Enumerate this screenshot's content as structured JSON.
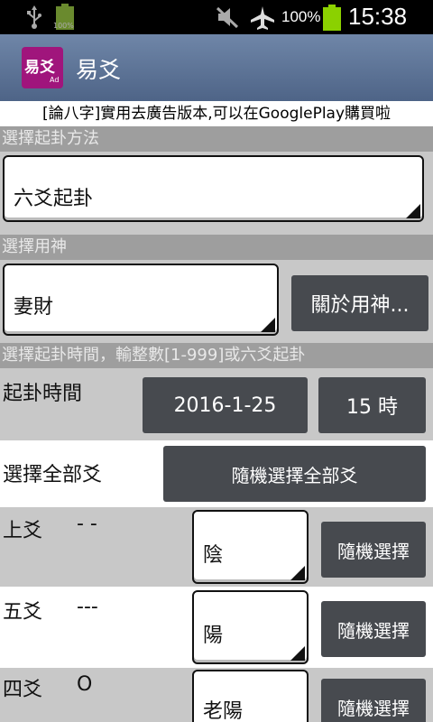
{
  "status_bar": {
    "small_battery_text": "100%",
    "battery_percent": "100%",
    "time": "15:38",
    "icons": [
      "usb-icon",
      "battery-small-icon",
      "mute-icon",
      "airplane-icon",
      "battery-icon"
    ]
  },
  "app": {
    "icon_text": "易爻",
    "icon_badge": "Ad",
    "title": "易爻"
  },
  "banner": "[論八字]實用去廣告版本,可以在GooglePlay購買啦",
  "method_section": {
    "label": "選擇起卦方法",
    "selected": "六爻起卦"
  },
  "yongshen_section": {
    "label": "選擇用神",
    "selected": "妻財",
    "about_button": "關於用神..."
  },
  "time_section": {
    "label": "選擇起卦時間，輸整數[1-999]或六爻起卦",
    "row_label": "起卦時間",
    "date_button": "2016-1-25",
    "hour_button": "15 時"
  },
  "all_yao": {
    "label": "選擇全部爻",
    "random_all_button": "隨機選擇全部爻"
  },
  "yao_rows": [
    {
      "name": "上爻",
      "symbol": "- -",
      "value": "陰",
      "button": "隨機選擇"
    },
    {
      "name": "五爻",
      "symbol": "---",
      "value": "陽",
      "button": "隨機選擇"
    },
    {
      "name": "四爻",
      "symbol": "O",
      "value": "老陽",
      "button": "隨機選擇"
    }
  ],
  "colors": {
    "action_bar": "#5a7195",
    "app_icon": "#a0157c",
    "button": "#474a4f",
    "section_label_bg": "#9e9e9e",
    "battery_green": "#8bd100"
  }
}
